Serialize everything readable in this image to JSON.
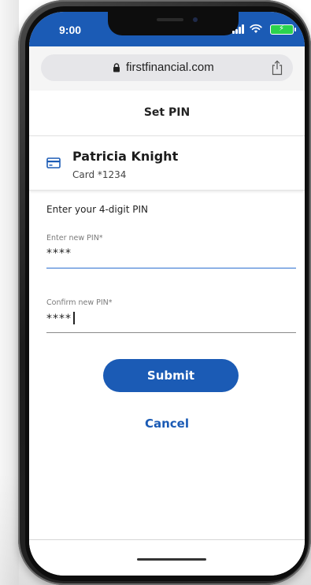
{
  "status_bar": {
    "time": "9:00",
    "color": "#1b5bb5"
  },
  "browser": {
    "url": "firstfinancial.com"
  },
  "page": {
    "title": "Set PIN"
  },
  "card": {
    "holder_name": "Patricia Knight",
    "card_number": "Card *1234"
  },
  "form": {
    "instruction": "Enter your 4-digit PIN",
    "new_pin": {
      "label": "Enter new PIN*",
      "value": "****"
    },
    "confirm_pin": {
      "label": "Confirm new PIN*",
      "value": "****"
    },
    "submit_label": "Submit",
    "cancel_label": "Cancel"
  },
  "colors": {
    "primary": "#1b5bb5",
    "active_underline": "#2c6fd1"
  },
  "icons": [
    "lock-icon",
    "share-icon",
    "credit-card-icon",
    "signal-icon",
    "wifi-icon",
    "battery-icon"
  ]
}
